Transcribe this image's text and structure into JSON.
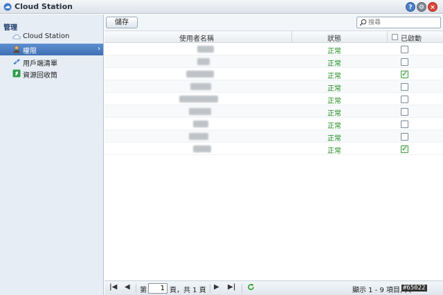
{
  "window": {
    "title": "Cloud Station",
    "help_glyph": "?",
    "min_glyph": "⚙",
    "close_glyph": "×"
  },
  "sidebar": {
    "section_title": "管理",
    "items": [
      {
        "label": "Cloud Station",
        "icon": "cloud-icon",
        "active": false
      },
      {
        "label": "權限",
        "icon": "user-icon",
        "active": true
      },
      {
        "label": "用戶端清單",
        "icon": "satellite-icon",
        "active": false
      },
      {
        "label": "資源回收筒",
        "icon": "recycle-bin-icon",
        "active": false
      }
    ],
    "active_arrow": "›"
  },
  "toolbar": {
    "save_label": "儲存",
    "search_placeholder": "搜尋"
  },
  "table": {
    "columns": {
      "username": "使用者名稱",
      "status": "狀態",
      "enabled": "已啟動"
    },
    "rows": [
      {
        "status": "正常",
        "enabled": false
      },
      {
        "status": "正常",
        "enabled": false
      },
      {
        "status": "正常",
        "enabled": true
      },
      {
        "status": "正常",
        "enabled": false
      },
      {
        "status": "正常",
        "enabled": false
      },
      {
        "status": "正常",
        "enabled": false
      },
      {
        "status": "正常",
        "enabled": false
      },
      {
        "status": "正常",
        "enabled": false
      },
      {
        "status": "正常",
        "enabled": true
      }
    ]
  },
  "pager": {
    "first": "|◀",
    "prev": "◀",
    "next": "▶",
    "last": "▶|",
    "page_prefix": "第",
    "page_value": "1",
    "page_suffix": "頁，共 1 頁",
    "summary": "顯示 1 - 9 項目, 共"
  },
  "watermark": "#65022",
  "colors": {
    "status_ok": "#1c8a1c",
    "active_item": "#4a7cc0",
    "check": "#2a9b2a"
  }
}
